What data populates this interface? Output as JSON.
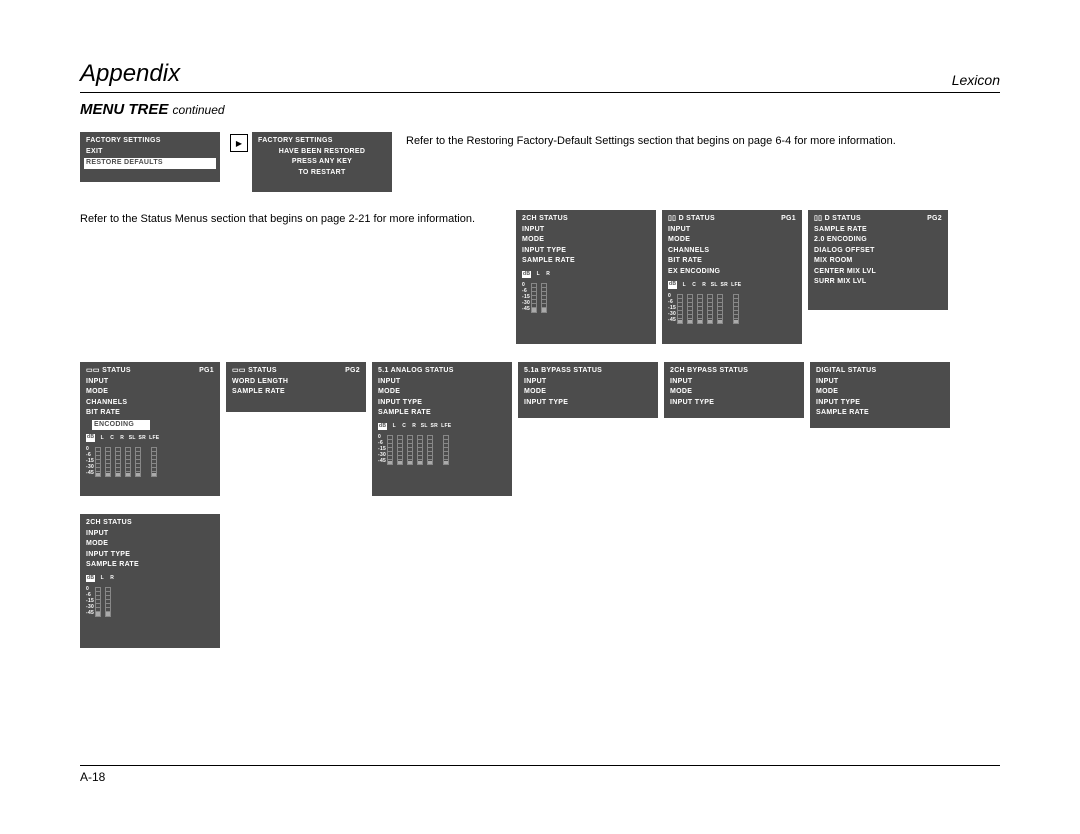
{
  "header": {
    "left": "Appendix",
    "right": "Lexicon"
  },
  "subtitle": {
    "main": "MENU TREE",
    "cont": "continued"
  },
  "factory_a": {
    "l1": "FACTORY  SETTINGS",
    "l2": "EXIT",
    "l3": "RESTORE  DEFAULTS"
  },
  "factory_b": {
    "l1": "FACTORY  SETTINGS",
    "l2": "HAVE  BEEN  RESTORED",
    "l3": "PRESS  ANY KEY",
    "l4": "TO  RESTART"
  },
  "note1": "Refer to the Restoring Factory-Default Settings section that begins on page 6-4 for more information.",
  "note2": "Refer to the Status Menus section that begins on page 2-21 for more information.",
  "p_2ch": {
    "title": "2CH STATUS",
    "r1": "INPUT",
    "r2": "MODE",
    "r3": "INPUT TYPE",
    "r4": "SAMPLE RATE"
  },
  "p_dd1": {
    "title": "D STATUS",
    "pg": "PG1",
    "r1": "INPUT",
    "r2": "MODE",
    "r3": "CHANNELS",
    "r4": "BIT RATE",
    "r5": "EX ENCODING"
  },
  "p_dd2": {
    "title": "D STATUS",
    "pg": "PG2",
    "r1": "SAMPLE RATE",
    "r2": "2.0 ENCODING",
    "r3": "DIALOG OFFSET",
    "r4": "MIX ROOM",
    "r5": "CENTER MIX LVL",
    "r6": "SURR MIX LVL"
  },
  "p_dts1": {
    "title": "STATUS",
    "pg": "PG1",
    "r1": "INPUT",
    "r2": "MODE",
    "r3": "CHANNELS",
    "r4": "BIT RATE",
    "r5": "ENCODING"
  },
  "p_dts2": {
    "title": "STATUS",
    "pg": "PG2",
    "r1": "WORD LENGTH",
    "r2": "SAMPLE RATE"
  },
  "p_51a": {
    "title": "5.1 ANALOG STATUS",
    "r1": "INPUT",
    "r2": "MODE",
    "r3": "INPUT TYPE",
    "r4": "SAMPLE RATE"
  },
  "p_51b": {
    "title": "5.1a  BYPASS STATUS",
    "r1": "INPUT",
    "r2": "MODE",
    "r3": "INPUT TYPE"
  },
  "p_2cb": {
    "title": "2CH BYPASS STATUS",
    "r1": "INPUT",
    "r2": "MODE",
    "r3": "INPUT TYPE"
  },
  "p_dig": {
    "title": "DIGITAL STATUS",
    "r1": "INPUT",
    "r2": "MODE",
    "r3": "INPUT TYPE",
    "r4": "SAMPLE RATE"
  },
  "p_2ch2": {
    "title": "2CH STATUS",
    "r1": "INPUT",
    "r2": "MODE",
    "r3": "INPUT TYPE",
    "r4": "SAMPLE RATE"
  },
  "db": {
    "l": "dB",
    "v0": "0",
    "v6": "-6",
    "v15": "-15",
    "v30": "-30",
    "v45": "-45"
  },
  "ch2": {
    "l": "L",
    "r": "R"
  },
  "ch6": {
    "l": "L",
    "c": "C",
    "r": "R",
    "sl": "SL",
    "sr": "SR",
    "lfe": "LFE"
  },
  "arrow": "▶",
  "icon_dd": "▯▯",
  "icon_dts": "▭▭",
  "page_num": "A-18"
}
